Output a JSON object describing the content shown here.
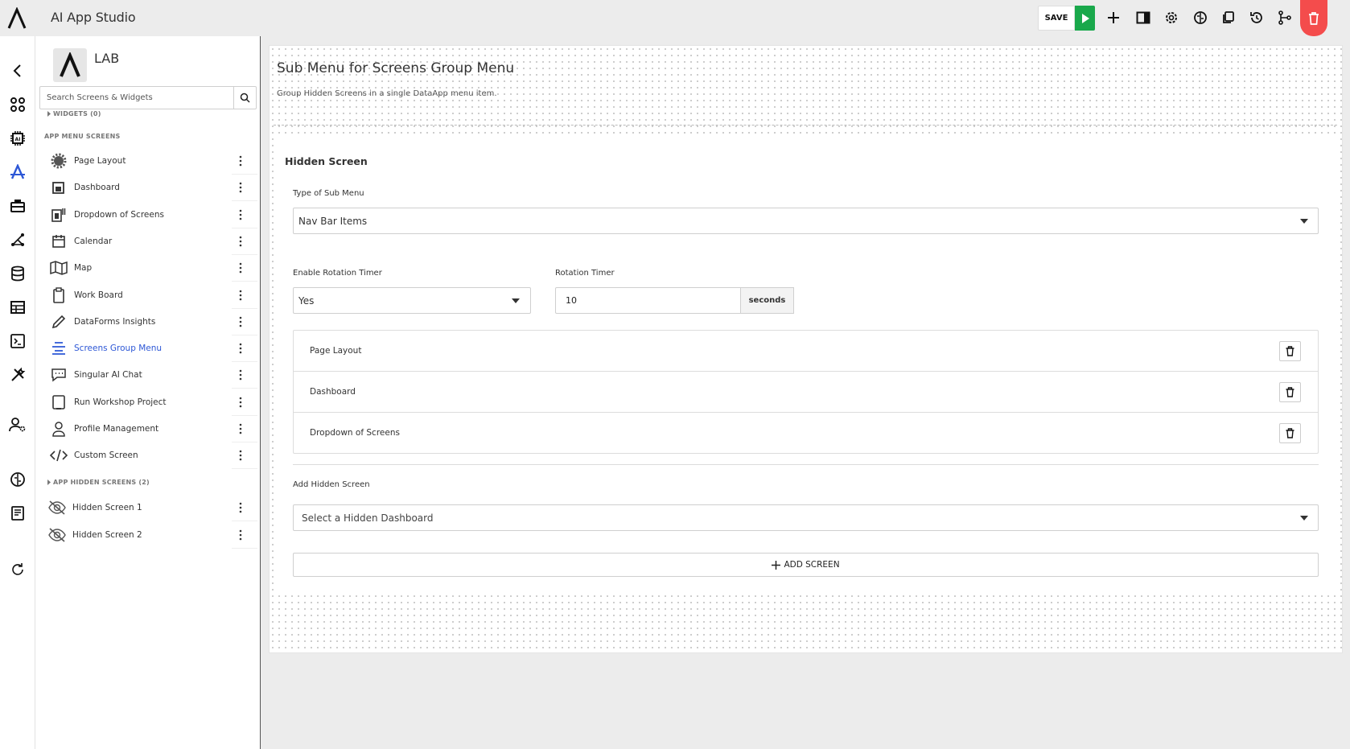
{
  "header": {
    "app_title": "AI App Studio",
    "save_label": "SAVE",
    "icons": [
      "play-icon",
      "plus-icon",
      "panel-icon",
      "gear-icon",
      "brain-icon",
      "copy-icon",
      "history-icon",
      "branch-icon",
      "trash-icon"
    ]
  },
  "rail": {
    "icons": [
      "back-icon",
      "apps-icon",
      "ai-chip-icon",
      "app-studio-icon",
      "toolbox-icon",
      "network-icon",
      "database-icon",
      "table-icon",
      "terminal-icon",
      "tools-icon",
      "user-settings-icon",
      "brain-icon",
      "notebook-icon",
      "refresh-icon"
    ]
  },
  "panel": {
    "lab_label": "LAB",
    "search_placeholder": "Search Screens & Widgets",
    "widgets_label": "WIDGETS (0)",
    "menu_section_label": "APP MENU SCREENS",
    "items": [
      {
        "label": "Page Layout",
        "icon": "gear-icon"
      },
      {
        "label": "Dashboard",
        "icon": "dashboard-icon"
      },
      {
        "label": "Dropdown of Screens",
        "icon": "dropdown-screens-icon"
      },
      {
        "label": "Calendar",
        "icon": "calendar-icon"
      },
      {
        "label": "Map",
        "icon": "map-icon"
      },
      {
        "label": "Work Board",
        "icon": "clipboard-icon"
      },
      {
        "label": "DataForms Insights",
        "icon": "pencil-icon"
      },
      {
        "label": "Screens Group Menu",
        "icon": "menu-lines-icon",
        "active": true
      },
      {
        "label": "Singular AI Chat",
        "icon": "chat-icon"
      },
      {
        "label": "Run Workshop Project",
        "icon": "tablet-icon"
      },
      {
        "label": "Profile Management",
        "icon": "user-icon"
      },
      {
        "label": "Custom Screen",
        "icon": "code-icon"
      }
    ],
    "hidden_section_label": "APP HIDDEN SCREENS (2)",
    "hidden_items": [
      {
        "label": "Hidden Screen 1",
        "icon": "eye-off-icon"
      },
      {
        "label": "Hidden Screen 2",
        "icon": "eye-off-icon"
      }
    ]
  },
  "main": {
    "title": "Sub Menu for Screens Group Menu",
    "subtitle": "Group Hidden Screens in a single DataApp menu item.",
    "form_title": "Hidden Screen",
    "type_label": "Type of Sub Menu",
    "type_value": "Nav Bar Items",
    "rotation_enable_label": "Enable Rotation Timer",
    "rotation_enable_value": "Yes",
    "rotation_timer_label": "Rotation Timer",
    "rotation_timer_value": "10",
    "rotation_timer_unit": "seconds",
    "screens": [
      "Page Layout",
      "Dashboard",
      "Dropdown of Screens"
    ],
    "add_hidden_label": "Add Hidden Screen",
    "add_hidden_placeholder": "Select a Hidden Dashboard",
    "add_button_label": "ADD SCREEN"
  },
  "colors": {
    "accent": "#2d57d6",
    "play": "#19a84b",
    "danger": "#f44c4c"
  }
}
